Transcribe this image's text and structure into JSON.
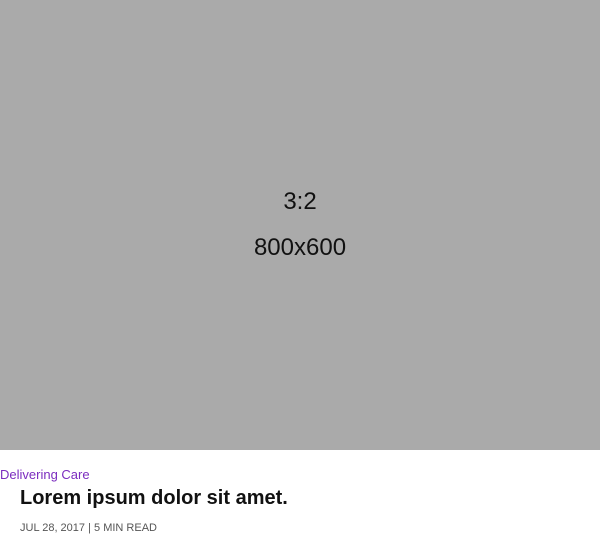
{
  "image": {
    "ratio_label": "3:2",
    "size_label": "800x600"
  },
  "article": {
    "category": "Delivering Care",
    "title": "Lorem ipsum dolor sit amet.",
    "date": "JUL 28, 2017",
    "separator": "|",
    "read_time": "5 MIN READ"
  },
  "colors": {
    "placeholder_bg": "#aaaaaa",
    "category_accent": "#7b2cbf",
    "title_text": "#111111",
    "meta_text": "#555555"
  }
}
